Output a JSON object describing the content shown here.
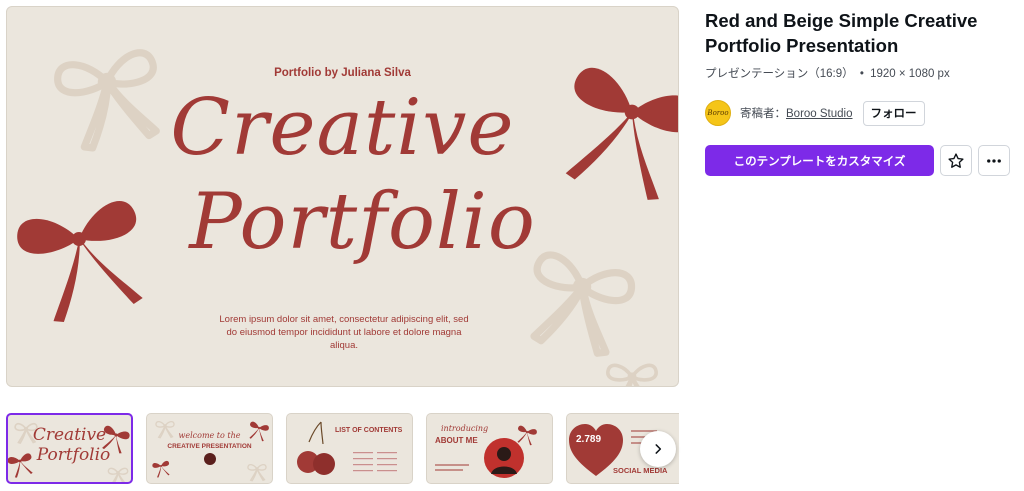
{
  "preview": {
    "subtitle": "Portfolio by Juliana Silva",
    "script_line1": "Creative",
    "script_line2": "Portfolio",
    "lorem": "Lorem ipsum dolor sit amet, consectetur adipiscing elit, sed do eiusmod tempor incididunt ut labore et dolore magna aliqua."
  },
  "template": {
    "title": "Red and Beige Simple Creative Portfolio Presentation",
    "type": "プレゼンテーション（16:9）",
    "dot": "•",
    "size": "1920 × 1080 px"
  },
  "author": {
    "avatar_text": "Boroo",
    "label": "寄稿者：",
    "name": "Boroo Studio",
    "follow": "フォロー"
  },
  "actions": {
    "customize": "このテンプレートをカスタマイズ",
    "favorite_icon": "star-icon",
    "more_icon": "more-icon"
  },
  "thumbnails": [
    {
      "script1": "Creative",
      "script2": "Portfolio"
    },
    {
      "script": "welcome to the",
      "heading": "CREATIVE PRESENTATION"
    },
    {
      "heading": "LIST OF CONTENTS"
    },
    {
      "script": "introducing",
      "heading": "ABOUT ME"
    },
    {
      "number": "2.789",
      "heading": "SOCIAL MEDIA"
    }
  ],
  "colors": {
    "accent": "#7d2ae8",
    "slide_bg": "#ebe6dd",
    "slide_red": "#a13a36",
    "bow_light": "#ddd2c4"
  }
}
